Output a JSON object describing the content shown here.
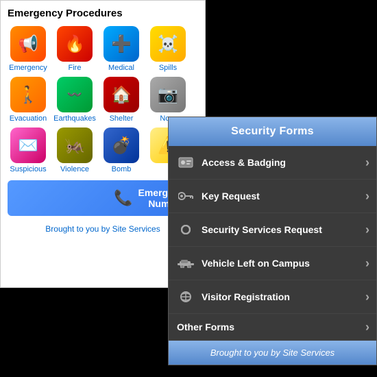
{
  "leftPanel": {
    "title": "Emergency Procedures",
    "icons": [
      {
        "label": "Emergency",
        "emoji": "📢",
        "bg": "bg-orange"
      },
      {
        "label": "Fire",
        "emoji": "🔥",
        "bg": "bg-red"
      },
      {
        "label": "Medical",
        "emoji": "➕",
        "bg": "bg-blue"
      },
      {
        "label": "Spills",
        "emoji": "☠️",
        "bg": "bg-yellow"
      },
      {
        "label": "Evacuation",
        "emoji": "🚶",
        "bg": "bg-orange2"
      },
      {
        "label": "Earthquakes",
        "emoji": "〰️",
        "bg": "bg-green"
      },
      {
        "label": "Shelter",
        "emoji": "🏠",
        "bg": "bg-red2"
      },
      {
        "label": "No...",
        "emoji": "📷",
        "bg": "bg-gray"
      },
      {
        "label": "Suspicious",
        "emoji": "✉️",
        "bg": "bg-pink"
      },
      {
        "label": "Violence",
        "emoji": "🦟",
        "bg": "bg-olive"
      },
      {
        "label": "Bomb",
        "emoji": "💣",
        "bg": "bg-darkblue"
      },
      {
        "label": "",
        "emoji": "⚠️",
        "bg": "bg-lightyellow"
      }
    ],
    "emergencyBtn": "Emergency\nNumbers",
    "footer": "Brought to you by Site Services"
  },
  "rightPanel": {
    "header": "Security Forms",
    "menuItems": [
      {
        "label": "Access & Badging",
        "iconType": "badge"
      },
      {
        "label": "Key Request",
        "iconType": "key"
      },
      {
        "label": "Security Services Request",
        "iconType": "circle"
      },
      {
        "label": "Vehicle Left on Campus",
        "iconType": "car"
      },
      {
        "label": "Visitor Registration",
        "iconType": "visitor"
      }
    ],
    "sectionHeader": "Other Forms",
    "footer": "Brought to you by Site Services"
  }
}
